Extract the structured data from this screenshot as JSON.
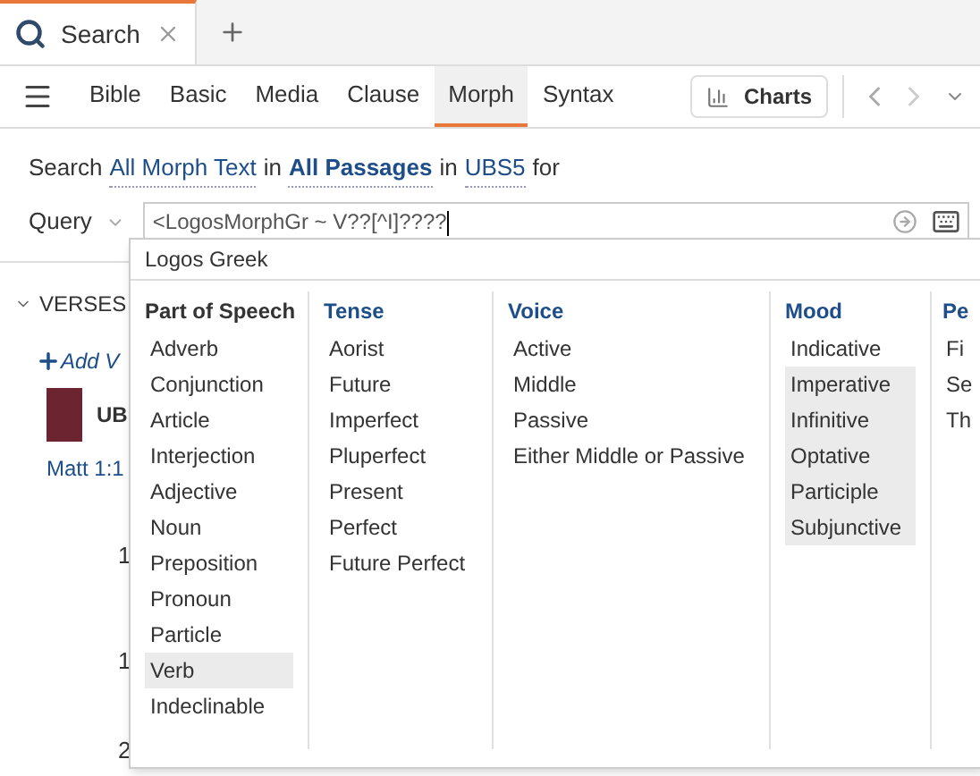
{
  "tabs": [
    {
      "label": "Search",
      "selected": true
    }
  ],
  "toolbar": {
    "search_types": [
      {
        "label": "Bible",
        "selected": false
      },
      {
        "label": "Basic",
        "selected": false
      },
      {
        "label": "Media",
        "selected": false
      },
      {
        "label": "Clause",
        "selected": false
      },
      {
        "label": "Morph",
        "selected": true
      },
      {
        "label": "Syntax",
        "selected": false
      }
    ],
    "charts_button": "Charts"
  },
  "search_line": {
    "parts": [
      {
        "text": "Search",
        "kind": "plain"
      },
      {
        "text": "All Morph Text",
        "kind": "link"
      },
      {
        "text": "in",
        "kind": "plain"
      },
      {
        "text": "All Passages",
        "kind": "bold-link"
      },
      {
        "text": "in",
        "kind": "plain"
      },
      {
        "text": "UBS5",
        "kind": "link"
      },
      {
        "text": "for",
        "kind": "plain"
      }
    ]
  },
  "query": {
    "label": "Query",
    "value": "<LogosMorphGr ~ V??[^I]????"
  },
  "results": {
    "section": "VERSES",
    "add_link": "Add V",
    "resource": "UB",
    "reference": "Matt 1:1",
    "verse_numbers": [
      "1",
      "1",
      "2"
    ]
  },
  "dropdown": {
    "title": "Logos Greek",
    "columns": [
      {
        "heading": "Part of Speech",
        "highlighted": false,
        "items": [
          {
            "label": "Adverb",
            "selected": false
          },
          {
            "label": "Conjunction",
            "selected": false
          },
          {
            "label": "Article",
            "selected": false
          },
          {
            "label": "Interjection",
            "selected": false
          },
          {
            "label": "Adjective",
            "selected": false
          },
          {
            "label": "Noun",
            "selected": false
          },
          {
            "label": "Preposition",
            "selected": false
          },
          {
            "label": "Pronoun",
            "selected": false
          },
          {
            "label": "Particle",
            "selected": false
          },
          {
            "label": "Verb",
            "selected": true
          },
          {
            "label": "Indeclinable",
            "selected": false
          }
        ]
      },
      {
        "heading": "Tense",
        "highlighted": true,
        "items": [
          {
            "label": "Aorist",
            "selected": false
          },
          {
            "label": "Future",
            "selected": false
          },
          {
            "label": "Imperfect",
            "selected": false
          },
          {
            "label": "Pluperfect",
            "selected": false
          },
          {
            "label": "Present",
            "selected": false
          },
          {
            "label": "Perfect",
            "selected": false
          },
          {
            "label": "Future Perfect",
            "selected": false
          }
        ]
      },
      {
        "heading": "Voice",
        "highlighted": true,
        "items": [
          {
            "label": "Active",
            "selected": false
          },
          {
            "label": "Middle",
            "selected": false
          },
          {
            "label": "Passive",
            "selected": false
          },
          {
            "label": "Either Middle or Passive",
            "selected": false
          }
        ]
      },
      {
        "heading": "Mood",
        "highlighted": true,
        "items": [
          {
            "label": "Indicative",
            "selected": false
          },
          {
            "label": "Imperative",
            "selected": true
          },
          {
            "label": "Infinitive",
            "selected": true
          },
          {
            "label": "Optative",
            "selected": true
          },
          {
            "label": "Participle",
            "selected": true
          },
          {
            "label": "Subjunctive",
            "selected": true
          }
        ]
      },
      {
        "heading": "Pe",
        "highlighted": true,
        "items": [
          {
            "label": "Fi",
            "selected": false
          },
          {
            "label": "Se",
            "selected": false
          },
          {
            "label": "Th",
            "selected": false
          }
        ]
      }
    ]
  }
}
